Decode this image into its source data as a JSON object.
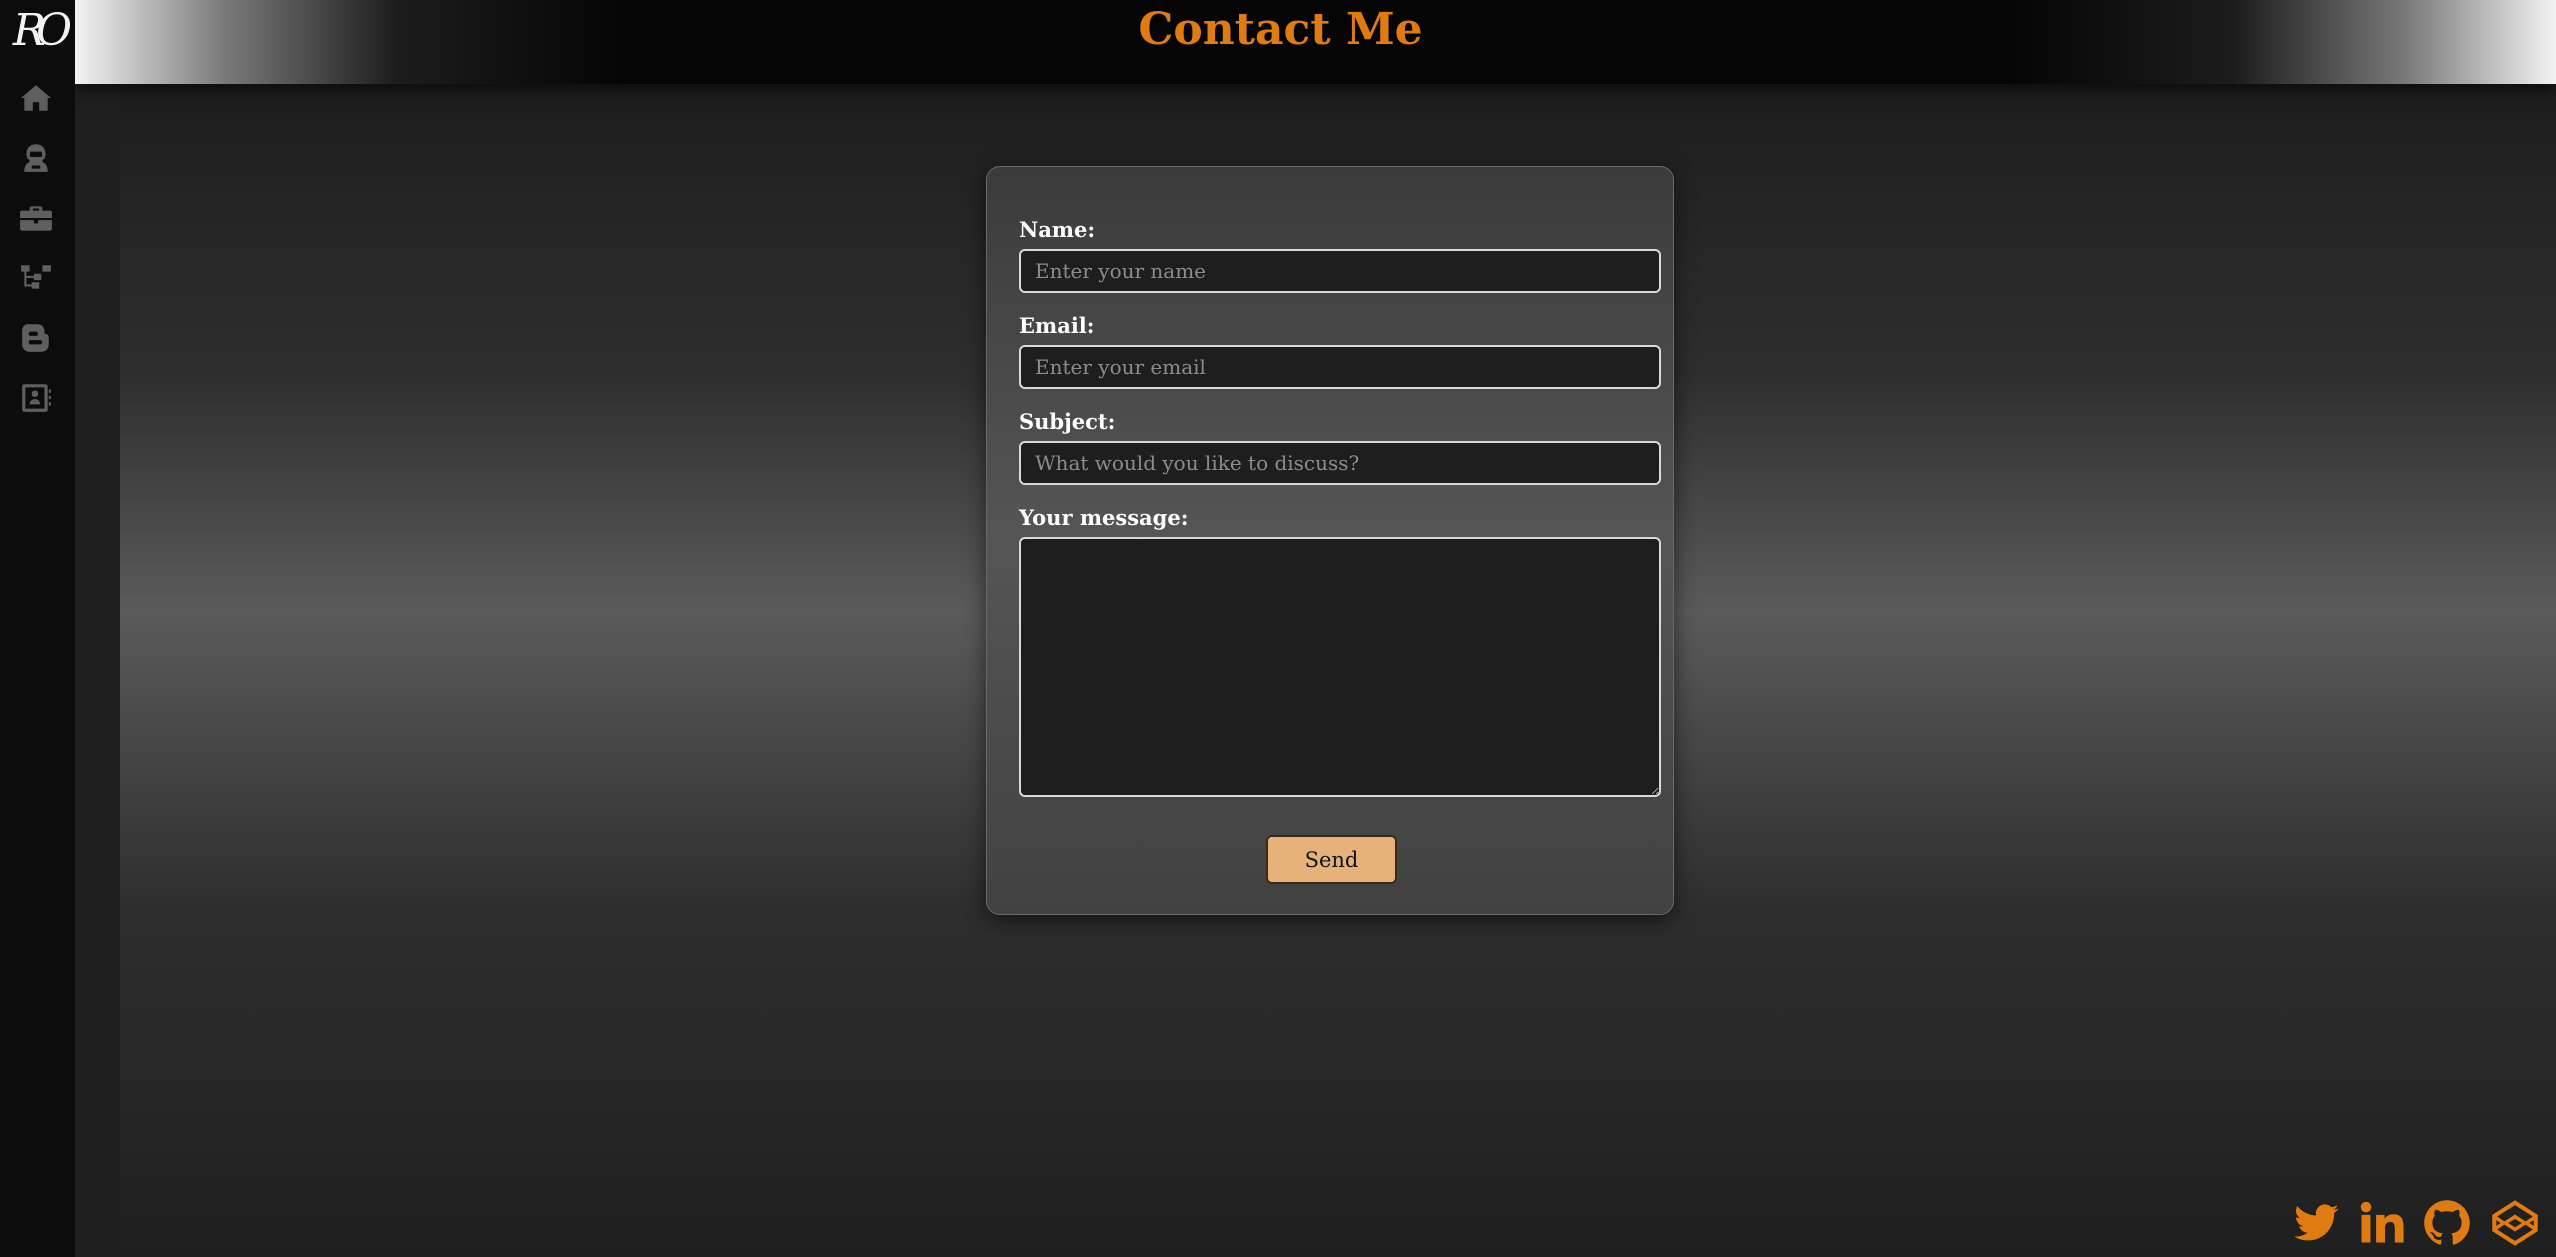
{
  "sidebar": {
    "logo": "RO",
    "items": [
      {
        "icon": "home-icon"
      },
      {
        "icon": "astronaut-icon"
      },
      {
        "icon": "briefcase-icon"
      },
      {
        "icon": "sitemap-icon"
      },
      {
        "icon": "blogger-icon"
      },
      {
        "icon": "contact-book-icon"
      }
    ]
  },
  "header": {
    "title": "Contact Me"
  },
  "form": {
    "name_label": "Name:",
    "name_placeholder": "Enter your name",
    "name_value": "",
    "email_label": "Email:",
    "email_placeholder": "Enter your email",
    "email_value": "",
    "subject_label": "Subject:",
    "subject_placeholder": "What would you like to discuss?",
    "subject_value": "",
    "message_label": "Your message:",
    "message_value": "",
    "send_label": "Send"
  },
  "social": [
    "twitter-icon",
    "linkedin-icon",
    "github-icon",
    "codepen-icon"
  ],
  "colors": {
    "accent": "#e07b12",
    "button": "#e6b27a",
    "sidebar": "#0c0c0c"
  }
}
